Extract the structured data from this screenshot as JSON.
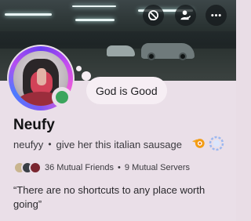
{
  "profile": {
    "display_name": "Neufy",
    "username": "neufyy",
    "pronoun_line": "give her this italian sausage",
    "custom_status": "God is Good",
    "status": "online",
    "bio": "“There are no shortcuts to any place worth going”"
  },
  "mutuals": {
    "friends": "36 Mutual Friends",
    "servers": "9 Mutual Servers"
  },
  "banner_actions": [
    {
      "name": "block-user-icon"
    },
    {
      "name": "add-friend-icon"
    },
    {
      "name": "more-options-icon"
    }
  ],
  "colors": {
    "status_online": "#3ba55d",
    "card_bg": "#eadfe8",
    "bubble_bg": "#f6eef4"
  }
}
